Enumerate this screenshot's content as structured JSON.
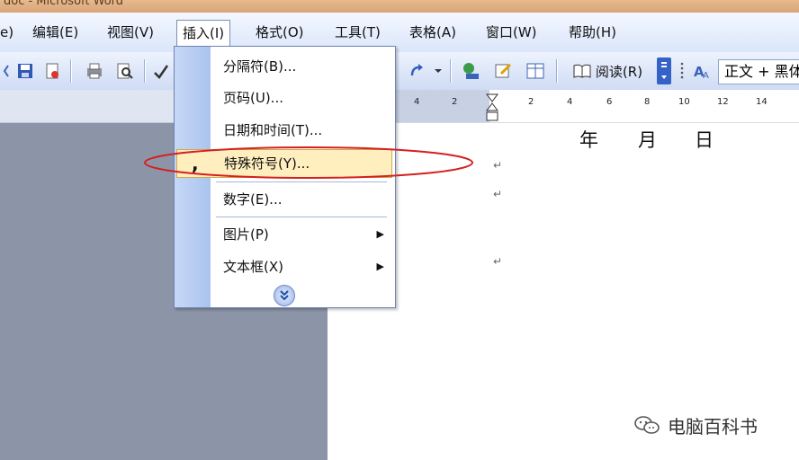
{
  "window": {
    "title": "doc - Microsoft Word"
  },
  "menubar": {
    "items": [
      "编辑(E)",
      "视图(V)",
      "插入(I)",
      "格式(O)",
      "工具(T)",
      "表格(A)",
      "窗口(W)",
      "帮助(H)"
    ],
    "left_partial": "e)"
  },
  "toolbar": {
    "read_label": "阅读(R)",
    "style_value": "正文 + 黑体"
  },
  "ruler": {
    "ticks": [
      "4",
      "2",
      "2",
      "4",
      "6",
      "8",
      "10",
      "12",
      "14"
    ]
  },
  "document": {
    "date_chars": [
      "年",
      "月",
      "日"
    ]
  },
  "insert_menu": {
    "items": [
      {
        "label": "分隔符(B)..."
      },
      {
        "label": "页码(U)..."
      },
      {
        "label": "日期和时间(T)..."
      },
      {
        "label": "特殊符号(Y)..."
      },
      {
        "label": "数字(E)..."
      },
      {
        "label": "图片(P)"
      },
      {
        "label": "文本框(X)"
      }
    ]
  },
  "watermark": {
    "text": "电脑百科书"
  }
}
